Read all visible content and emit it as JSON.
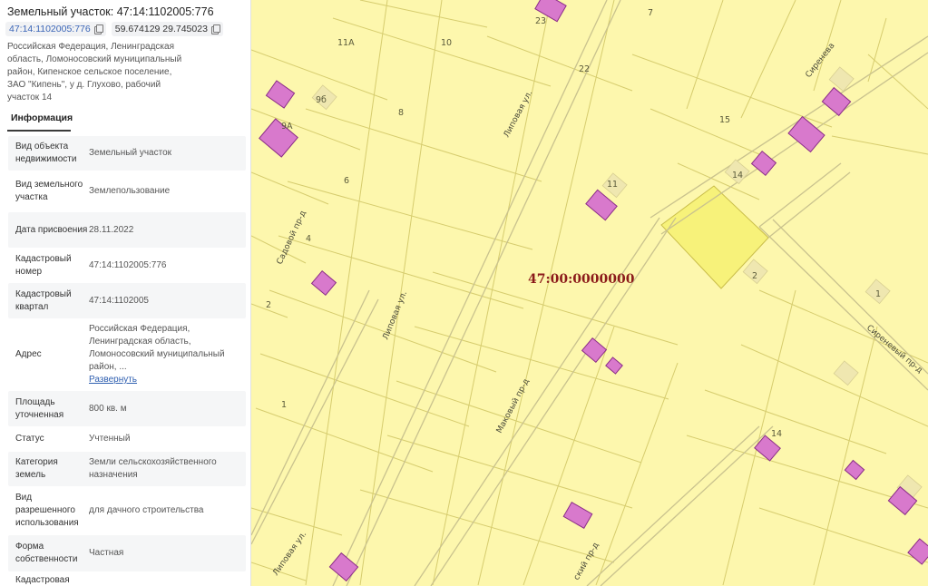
{
  "panel": {
    "title": "Земельный участок: 47:14:1102005:776",
    "cadastral_link": "47:14:1102005:776",
    "coordinates": "59.674129 29.745023",
    "address": "Российская Федерация, Ленинградская область, Ломоносовский муниципальный район, Кипенское сельское поселение, ЗАО \"Кипень\", у д. Глухово, рабочий участок 14",
    "tab": "Информация",
    "rows": [
      {
        "key": "Вид объекта недвижимости",
        "value": "Земельный участок"
      },
      {
        "key": "Вид земельного участка",
        "value": "Землепользование"
      },
      {
        "key": "Дата присвоения",
        "value": "28.11.2022"
      },
      {
        "key": "Кадастровый номер",
        "value": "47:14:1102005:776"
      },
      {
        "key": "Кадастровый квартал",
        "value": "47:14:1102005"
      },
      {
        "key": "Адрес",
        "value": "Российская Федерация, Ленинградская область, Ломоносовский муниципальный район, ...",
        "more": "Развернуть"
      },
      {
        "key": "Площадь уточненная",
        "value": "800 кв. м"
      },
      {
        "key": "Статус",
        "value": "Учтенный"
      },
      {
        "key": "Категория земель",
        "value": "Земли сельскохозяйственного назначения"
      },
      {
        "key": "Вид разрешенного использования",
        "value": "для дачного строительства"
      },
      {
        "key": "Форма собственности",
        "value": "Частная"
      },
      {
        "key": "Кадастровая",
        "value": ""
      }
    ]
  },
  "map": {
    "quarter_label": "47:00:0000000",
    "colors": {
      "background": "#fdf7ad",
      "parcel_line": "#d6cc6e",
      "road_edge": "#c9c28e",
      "building": "#d879cc",
      "building_stroke": "#8a2d87",
      "selected": "#f7f27a"
    },
    "streets": [
      "Липовая ул.",
      "Липовая ул.",
      "Маковый пр-д",
      "Сиреневый пр-д",
      "Сиренева",
      "Садовой пр-д",
      "Липовая ул.",
      "ский пр-д"
    ],
    "plot_numbers": [
      "23",
      "7",
      "11А",
      "10",
      "22",
      "9б",
      "8",
      "9А",
      "15",
      "14",
      "6",
      "11",
      "4",
      "2",
      "2",
      "1",
      "1",
      "14"
    ]
  }
}
